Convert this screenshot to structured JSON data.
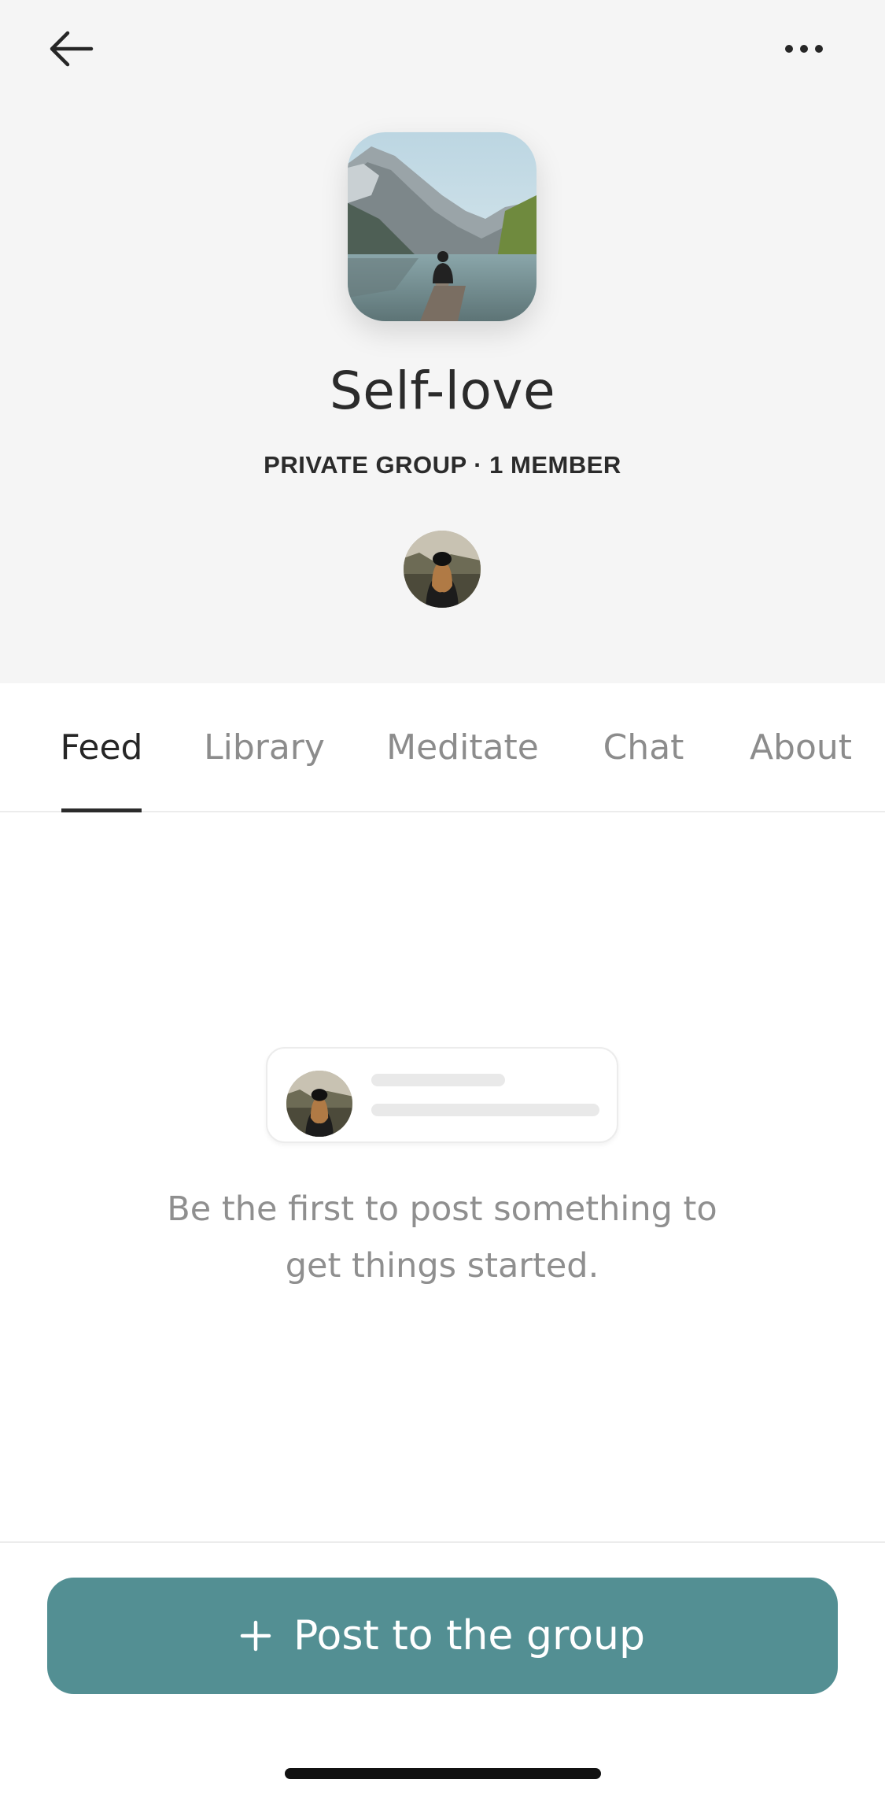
{
  "header": {
    "title": "Self-love",
    "meta": "PRIVATE GROUP · 1 MEMBER",
    "back_icon": "arrow-left-icon",
    "more_icon": "more-horizontal-icon"
  },
  "tabs": [
    {
      "label": "Feed",
      "active": true
    },
    {
      "label": "Library",
      "active": false
    },
    {
      "label": "Meditate",
      "active": false
    },
    {
      "label": "Chat",
      "active": false
    },
    {
      "label": "About",
      "active": false
    }
  ],
  "empty_state": {
    "line1": "Be the first to post something to",
    "line2": "get things started."
  },
  "post_button": {
    "label": "Post to the group",
    "icon": "plus-icon"
  },
  "colors": {
    "accent": "#538f93",
    "header_bg": "#f5f5f5",
    "text_dark": "#2b2b2b",
    "text_muted": "#8c8c8c"
  }
}
